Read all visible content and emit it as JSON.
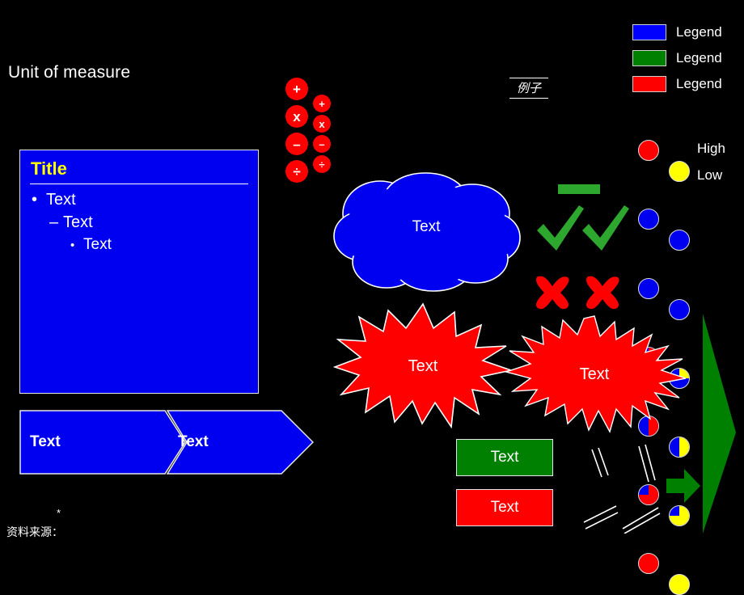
{
  "slide": {
    "background": "#000000",
    "unit_of_measure": "Unit of measure",
    "footer_asterisk": "*",
    "footer_source": "资料来源："
  },
  "title_box": {
    "title": "Title",
    "bullet_l1_marker": "•",
    "bullet_l1": "Text",
    "bullet_l2_marker": "–",
    "bullet_l2": "Text",
    "bullet_l3_marker": "•",
    "bullet_l3": "Text",
    "fill": "#0000F0",
    "title_color": "#FFFF00"
  },
  "chevron_band": {
    "segment1_label": "Text",
    "segment2_label": "Text",
    "fill": "#0000F0"
  },
  "operators": {
    "large": [
      "+",
      "x",
      "–",
      "÷"
    ],
    "small": [
      "+",
      "x",
      "–",
      "÷"
    ],
    "fill": "#FF0000",
    "glyph_color": "#FFFFFF"
  },
  "example_mark": {
    "text": "例子"
  },
  "legend": {
    "items": [
      {
        "label": "Legend",
        "color": "#0000FF"
      },
      {
        "label": "Legend",
        "color": "#008000"
      },
      {
        "label": "Legend",
        "color": "#FF0000"
      }
    ]
  },
  "harvey_balls": {
    "scale_high_label": "High",
    "scale_low_label": "Low",
    "base_color": "#0000F0",
    "left_accent": "#FF0000",
    "right_accent": "#FFFF00",
    "rows": [
      {
        "fill": "full-accent",
        "left": "#FF0000",
        "right": "#FFFF00"
      },
      {
        "fill": "empty",
        "left": "#0000F0",
        "right": "#0000F0"
      },
      {
        "fill": "empty",
        "left": "#0000F0",
        "right": "#0000F0"
      },
      {
        "fill": "quarter",
        "left": "#FF0000",
        "right": "#FFFF00"
      },
      {
        "fill": "half",
        "left": "#FF0000",
        "right": "#FFFF00"
      },
      {
        "fill": "three-quarter",
        "left": "#FF0000",
        "right": "#FFFF00"
      },
      {
        "fill": "full-accent",
        "left": "#FF0000",
        "right": "#FFFF00"
      }
    ]
  },
  "cloud": {
    "label": "Text",
    "fill": "#0000F0"
  },
  "starbursts": [
    {
      "label": "Text",
      "fill": "#FF0000",
      "points": 20
    },
    {
      "label": "Text",
      "fill": "#FF0000",
      "points": 28
    }
  ],
  "marks": {
    "dash_color": "#2EA72E",
    "check_color": "#2EA72E",
    "cross_color": "#FF0000",
    "check_count": 2,
    "cross_count": 2
  },
  "boxes": [
    {
      "label": "Text",
      "fill": "#008000"
    },
    {
      "label": "Text",
      "fill": "#FF0000"
    }
  ],
  "arrows": {
    "tall_fill": "#008000",
    "small_fill": "#008000"
  },
  "break_marks": {
    "color": "#FFFFFF",
    "count": 4
  }
}
